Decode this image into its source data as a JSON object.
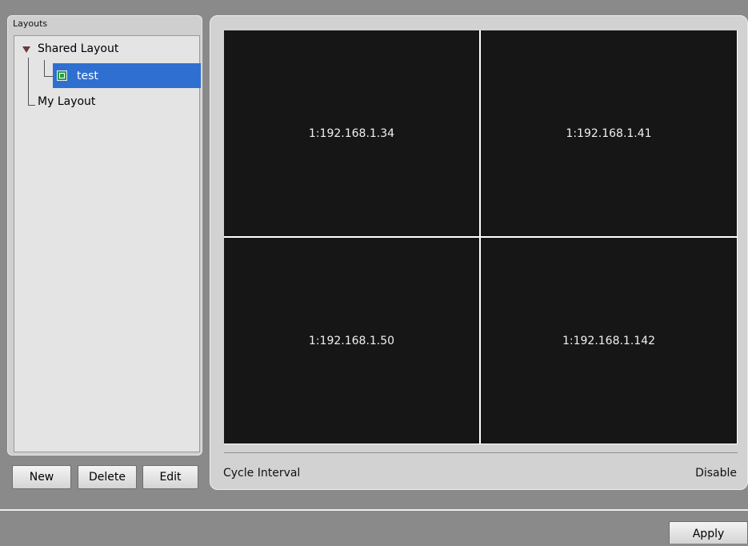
{
  "layouts": {
    "header": "Layouts",
    "tree": {
      "shared": {
        "label": "Shared Layout",
        "children": [
          {
            "label": "test",
            "selected": true,
            "icon": "layout-icon"
          }
        ]
      },
      "mine": {
        "label": "My Layout"
      }
    },
    "buttons": {
      "new": "New",
      "delete": "Delete",
      "edit": "Edit"
    }
  },
  "preview": {
    "cells": [
      "1:192.168.1.34",
      "1:192.168.1.41",
      "1:192.168.1.50",
      "1:192.168.1.142"
    ],
    "cycle_interval_label": "Cycle Interval",
    "cycle_interval_value": "Disable"
  },
  "footer": {
    "apply": "Apply"
  },
  "colors": {
    "selection": "#2f6fd0",
    "video_bg": "#161616",
    "window_bg": "#8a8a8a"
  }
}
